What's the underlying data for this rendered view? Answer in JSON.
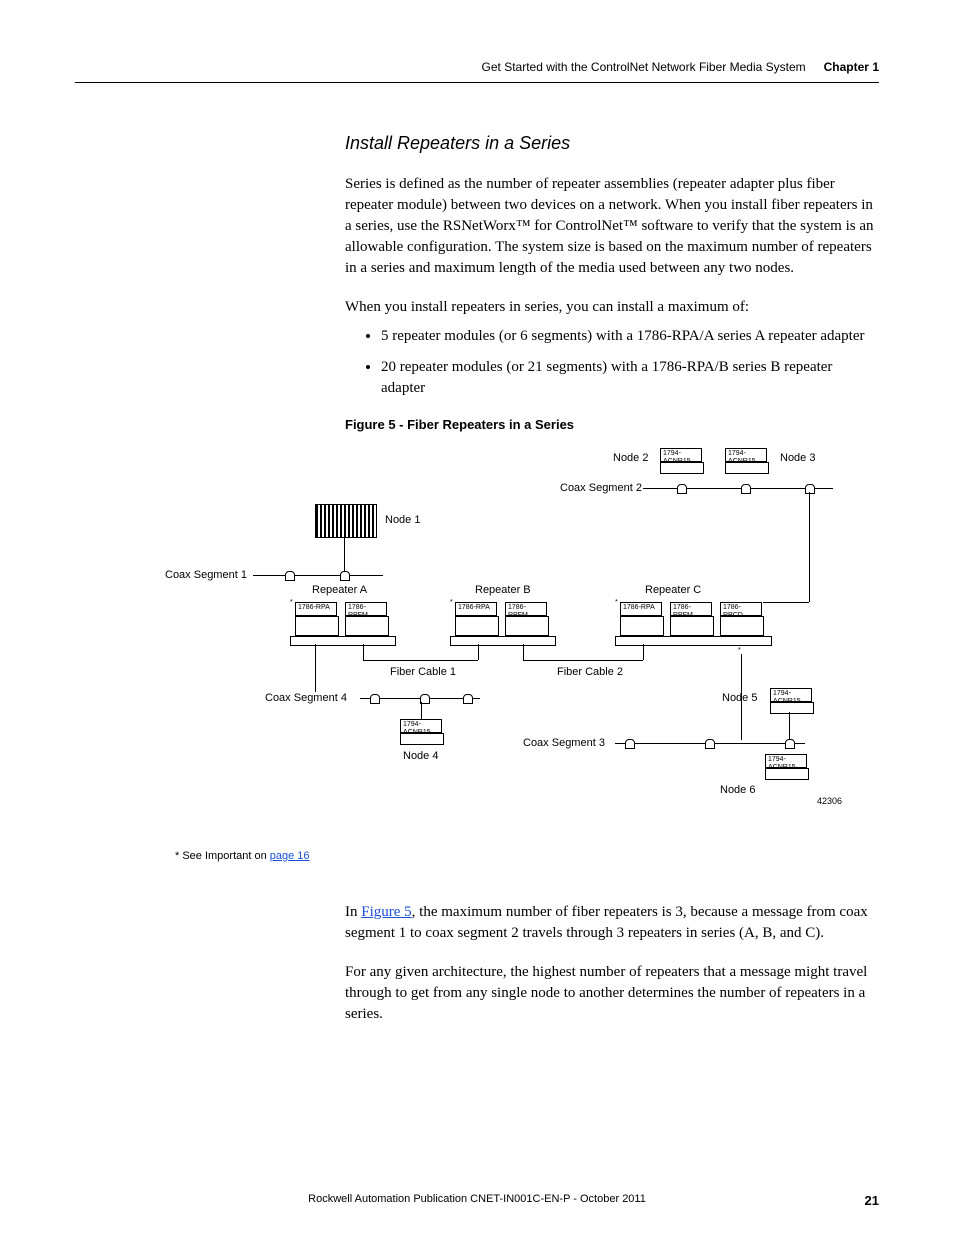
{
  "header": {
    "doc_section": "Get Started with the ControlNet Network Fiber Media System",
    "chapter": "Chapter 1"
  },
  "section_title": "Install Repeaters in a Series",
  "para1": "Series is defined as the number of repeater assemblies (repeater adapter plus fiber repeater module) between two devices on a network. When you install fiber repeaters in a series, use the RSNetWorx™ for ControlNet™ software to verify that the system is an allowable configuration. The system size is based on the maximum number of repeaters in a series and maximum length of the media used between any two nodes.",
  "para2": "When you install repeaters in series, you can install a maximum of:",
  "bullets": {
    "b1": "5 repeater modules (or 6 segments) with a 1786-RPA/A series A repeater adapter",
    "b2": "20 repeater modules (or 21 segments) with a 1786-RPA/B series B repeater adapter"
  },
  "figure": {
    "caption": "Figure 5 - Fiber Repeaters in a Series",
    "node1": "Node 1",
    "node2": "Node 2",
    "node3": "Node 3",
    "node4": "Node 4",
    "node5": "Node 5",
    "node6": "Node 6",
    "coax1": "Coax Segment 1",
    "coax2": "Coax Segment 2",
    "coax3": "Coax Segment 3",
    "coax4": "Coax Segment 4",
    "repA": "Repeater A",
    "repB": "Repeater B",
    "repC": "Repeater C",
    "fiber1": "Fiber Cable 1",
    "fiber2": "Fiber Cable 2",
    "mod_rpa": "1786-RPA",
    "mod_rpfm": "1786-RPFM",
    "mod_rpcd": "1786-RPCD",
    "mod_acnr": "1794-ACNR15",
    "id": "42306"
  },
  "footnote": {
    "prefix": "* See Important on ",
    "link": "page 16"
  },
  "para3_pre": "In ",
  "para3_link": "Figure 5",
  "para3_post": ", the maximum number of fiber repeaters is 3, because a message from coax segment 1 to coax segment 2 travels through 3 repeaters in series (A, B, and C).",
  "para4": "For any given architecture, the highest number of repeaters that a message might travel through to get from any single node to another determines the number of repeaters in a series.",
  "footer": {
    "pub": "Rockwell Automation Publication CNET-IN001C-EN-P - October 2011",
    "page": "21"
  }
}
